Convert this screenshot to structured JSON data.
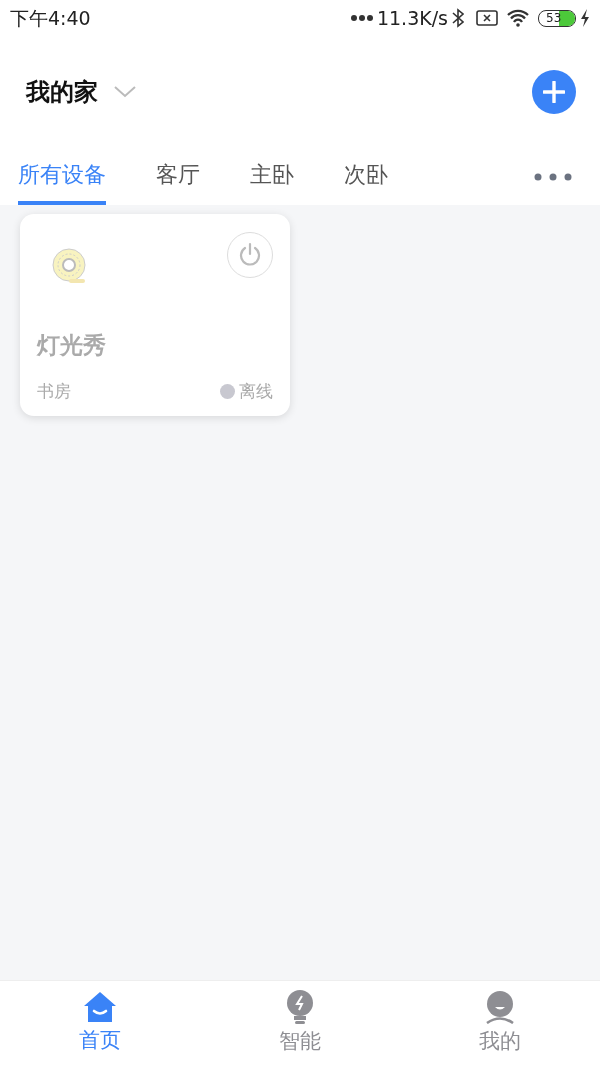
{
  "status_bar": {
    "time": "下午4:40",
    "net_speed": "11.3K/s",
    "battery": "53"
  },
  "header": {
    "title": "我的家"
  },
  "tabs": [
    {
      "label": "所有设备",
      "selected": true
    },
    {
      "label": "客厅",
      "selected": false
    },
    {
      "label": "主卧",
      "selected": false
    },
    {
      "label": "次卧",
      "selected": false
    }
  ],
  "devices": [
    {
      "name": "灯光秀",
      "room": "书房",
      "status": "离线",
      "online": false
    }
  ],
  "bottom_nav": [
    {
      "label": "首页",
      "kind": "home",
      "selected": true
    },
    {
      "label": "智能",
      "kind": "smart",
      "selected": false
    },
    {
      "label": "我的",
      "kind": "profile",
      "selected": false
    }
  ]
}
